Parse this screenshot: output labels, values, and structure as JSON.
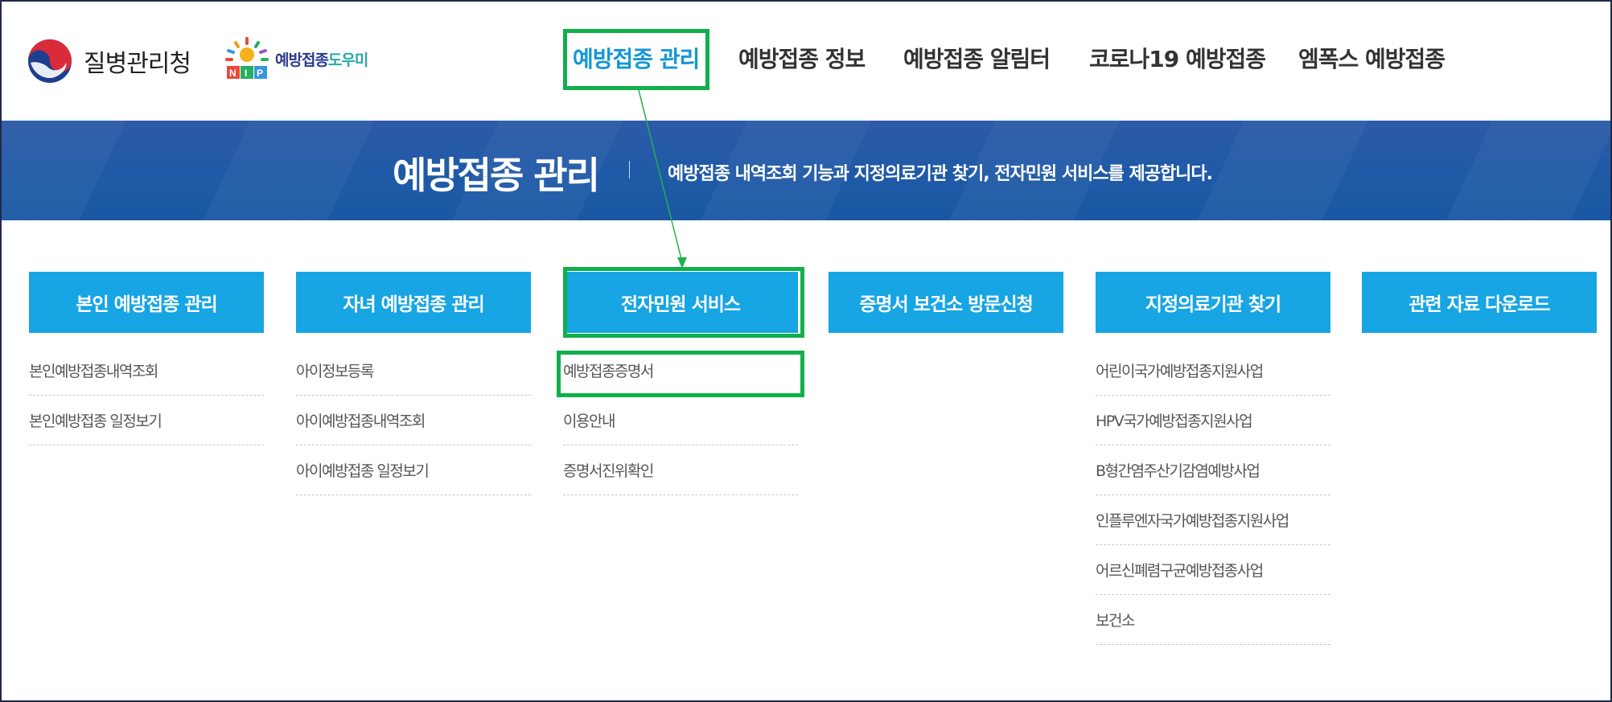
{
  "header": {
    "org_name": "질병관리청",
    "helper_logo": {
      "part1": "예방접종",
      "part2": "도우미",
      "badge": "NIP"
    },
    "nav": [
      {
        "label": "예방접종 관리",
        "active": true
      },
      {
        "label": "예방접종 정보",
        "active": false
      },
      {
        "label": "예방접종 알림터",
        "active": false
      },
      {
        "label": "코로나19 예방접종",
        "active": false
      },
      {
        "label": "엠폭스 예방접종",
        "active": false
      }
    ]
  },
  "banner": {
    "title": "예방접종 관리",
    "description": "예방접종 내역조회 기능과 지정의료기관 찾기, 전자민원 서비스를 제공합니다."
  },
  "menu": [
    {
      "title": "본인 예방접종 관리",
      "items": [
        "본인예방접종내역조회",
        "본인예방접종 일정보기"
      ]
    },
    {
      "title": "자녀 예방접종 관리",
      "items": [
        "아이정보등록",
        "아이예방접종내역조회",
        "아이예방접종 일정보기"
      ]
    },
    {
      "title": "전자민원 서비스",
      "items": [
        "예방접종증명서",
        "이용안내",
        "증명서진위확인"
      ]
    },
    {
      "title": "증명서 보건소 방문신청",
      "items": []
    },
    {
      "title": "지정의료기관 찾기",
      "items": [
        "어린이국가예방접종지원사업",
        "HPV국가예방접종지원사업",
        "B형간염주산기감염예방사업",
        "인플루엔자국가예방접종지원사업",
        "어르신폐렴구균예방접종사업",
        "보건소"
      ]
    },
    {
      "title": "관련 자료 다운로드",
      "items": []
    }
  ],
  "colors": {
    "accent": "#17a5e3",
    "active_nav": "#1597d4",
    "banner": "#1f5aa6",
    "highlight": "#10b04a"
  },
  "icons": [
    "kdca-emblem-icon",
    "nip-sun-icon"
  ]
}
